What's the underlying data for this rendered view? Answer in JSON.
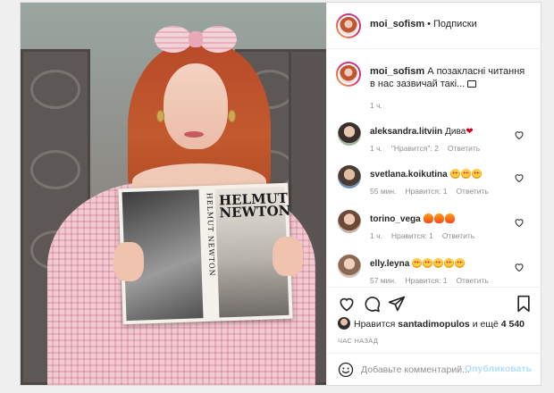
{
  "post": {
    "username": "moi_sofism",
    "separator": "•",
    "follow_label": "Подписки"
  },
  "photo": {
    "book_spine_text": "HELMUT NEWTON",
    "book_cover_text": "HELMUT NEWTON"
  },
  "caption": {
    "username": "moi_sofism",
    "text": "А позакласні читання в нас зазвичай такі...",
    "time": "1 ч.",
    "emoji": "book-emoji"
  },
  "comments": [
    {
      "username": "aleksandra.litviin",
      "text": "Дива",
      "emoji": [
        "red-heart"
      ],
      "time": "1 ч.",
      "likes": "\"Нравится\": 2",
      "reply": "Ответить"
    },
    {
      "username": "svetlana.koikutina",
      "text": "",
      "emoji": [
        "heart-eyes",
        "heart-eyes",
        "heart-eyes"
      ],
      "time": "55 мин.",
      "likes": "Нравится: 1",
      "reply": "Ответить"
    },
    {
      "username": "torino_vega",
      "text": "",
      "emoji": [
        "fire",
        "fire",
        "fire"
      ],
      "time": "1 ч.",
      "likes": "Нравится: 1",
      "reply": "Ответить"
    },
    {
      "username": "elly.leyna",
      "text": "",
      "emoji": [
        "heart-eyes",
        "heart-eyes",
        "heart-eyes",
        "heart-eyes",
        "heart-eyes"
      ],
      "time": "57 мин.",
      "likes": "Нравится: 1",
      "reply": "Ответить"
    }
  ],
  "likes": {
    "prefix": "Нравится",
    "user": "santadimopulos",
    "suffix": "и ещё",
    "count": "4 540"
  },
  "posted_ago": "час назад",
  "add_comment": {
    "placeholder": "Добавьте комментарий...",
    "publish_label": "Опубликовать"
  },
  "colors": {
    "link_disabled": "#b2dffc",
    "muted_text": "#8e8e8e",
    "border": "#efefef"
  }
}
